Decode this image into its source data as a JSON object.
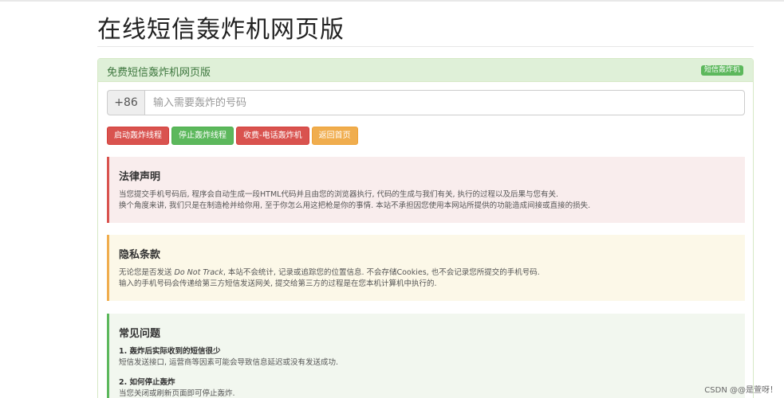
{
  "page": {
    "title": "在线短信轰炸机网页版"
  },
  "panel": {
    "heading": "免费短信轰炸机网页版",
    "badge": "短信轰炸机"
  },
  "phone": {
    "country_code": "+86",
    "placeholder": "输入需要轰炸的号码",
    "value": ""
  },
  "buttons": {
    "start": "启动轰炸线程",
    "stop": "停止轰炸线程",
    "paid": "收费-电话轰炸机",
    "home": "返回首页"
  },
  "law": {
    "title": "法律声明",
    "line1": "当您提交手机号码后, 程序会自动生成一段HTML代码并且由您的浏览器执行, 代码的生成与我们有关, 执行的过程以及后果与您有关.",
    "line2": "换个角度来讲, 我们只是在制造枪并给你用, 至于你怎么用这把枪是你的事情. 本站不承担因您使用本网站所提供的功能造成间接或直接的损失."
  },
  "privacy": {
    "title": "隐私条款",
    "line1_prefix": "无论您是否发送 ",
    "line1_em": "Do Not Track",
    "line1_suffix": ", 本站不会统计, 记录或追踪您的位置信息. 不会存储Cookies, 也不会记录您所提交的手机号码.",
    "line2": "输入的手机号码会传递给第三方短信发送网关, 提交给第三方的过程是在您本机计算机中执行的."
  },
  "faq": {
    "title": "常见问题",
    "items": [
      {
        "q": "1. 轰炸后实际收到的短信很少",
        "a": "短信发送接口, 运营商等因素可能会导致信息延迟或没有发送成功."
      },
      {
        "q": "2. 如何停止轰炸",
        "a": "当您关闭或刷新页面即可停止轰炸."
      }
    ]
  },
  "watermark": "CSDN @@是萱呀！"
}
